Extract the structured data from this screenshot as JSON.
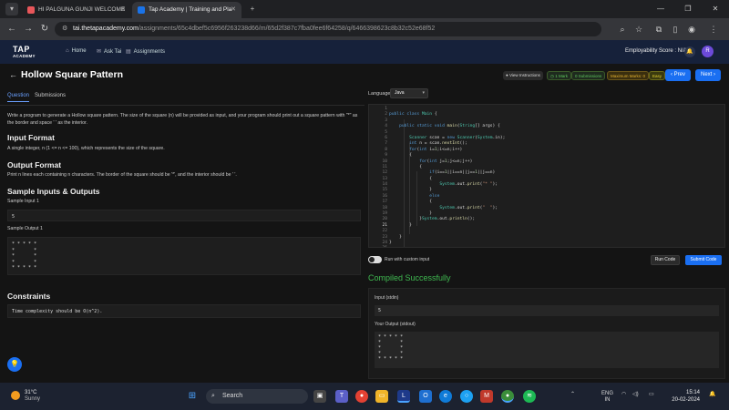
{
  "browser": {
    "tabs": [
      {
        "title": "HI PALGUNA GUNJI WELCOME",
        "favicon_color": "#e8565a"
      },
      {
        "title": "Tap Academy | Training and Pla",
        "favicon_color": "#1a73e8"
      }
    ],
    "url_host": "tai.thetapacademy.com",
    "url_path": "/assignments/65c4dbef5c6956f263238d66/m/65d2f387c7fba0fee6f64258/q/6466398623c8b32c52e68f52"
  },
  "site": {
    "logo_main": "TAP",
    "logo_sub": "ACADEMY",
    "nav": [
      {
        "label": "Home",
        "icon": "home-icon"
      },
      {
        "label": "Ask Tai",
        "icon": "chat-icon"
      },
      {
        "label": "Assignments",
        "icon": "clipboard-icon"
      }
    ],
    "employability": "Employability Score : N/A",
    "avatar": "R"
  },
  "problem": {
    "title": "Hollow Square Pattern",
    "chips": [
      "View Instructions",
      "1 Mark",
      "0 Submissions",
      "Maximum Marks: 0",
      "Easy"
    ],
    "prev_label": "Prev",
    "next_label": "Next",
    "tabs": [
      "Question",
      "Submissions"
    ],
    "statement": "Write a program to generate a Hollow square pattern. The size of the square (n) will be provided as input, and your program should print out a square pattern with \"*\" as the border and space ' ' as the interior.",
    "input_format_heading": "Input Format",
    "input_format": "A single integer, n (1 <= n <= 100), which represents the size of the square.",
    "output_format_heading": "Output Format",
    "output_format": "Print n lines each containing n characters. The border of the square should be '*', and the interior should be ' '.",
    "samples_heading": "Sample Inputs & Outputs",
    "sample_input_label": "Sample Input 1",
    "sample_input": "5",
    "sample_output_label": "Sample Output 1",
    "sample_output": "* * * * *\n*       *\n*       *\n*       *\n* * * * *",
    "constraints_heading": "Constraints",
    "constraints": "Time complexity should be O(n^2)."
  },
  "editor": {
    "language_label": "Language",
    "language": "Java",
    "line_numbers": [
      "1",
      "2",
      "3",
      "4",
      "5",
      "6",
      "7",
      "8",
      "9",
      "10",
      "11",
      "12",
      "13",
      "14",
      "15",
      "16",
      "17",
      "18",
      "19",
      "20",
      "21",
      "22",
      "23",
      "24",
      "25"
    ],
    "custom_input_label": "Run with custom input",
    "run_label": "Run Code",
    "submit_label": "Submit Code",
    "status": "Compiled Successfully",
    "stdin_label": "Input (stdin)",
    "stdin_value": "5",
    "stdout_label": "Your Output (stdout)",
    "stdout_value": "* * * * *\n*       *\n*       *\n*       *\n* * * * *"
  },
  "taskbar": {
    "temp": "31°C",
    "weather": "Sunny",
    "search_placeholder": "Search",
    "lang": "ENG",
    "region": "IN",
    "time": "15:14",
    "date": "20-02-2024"
  }
}
